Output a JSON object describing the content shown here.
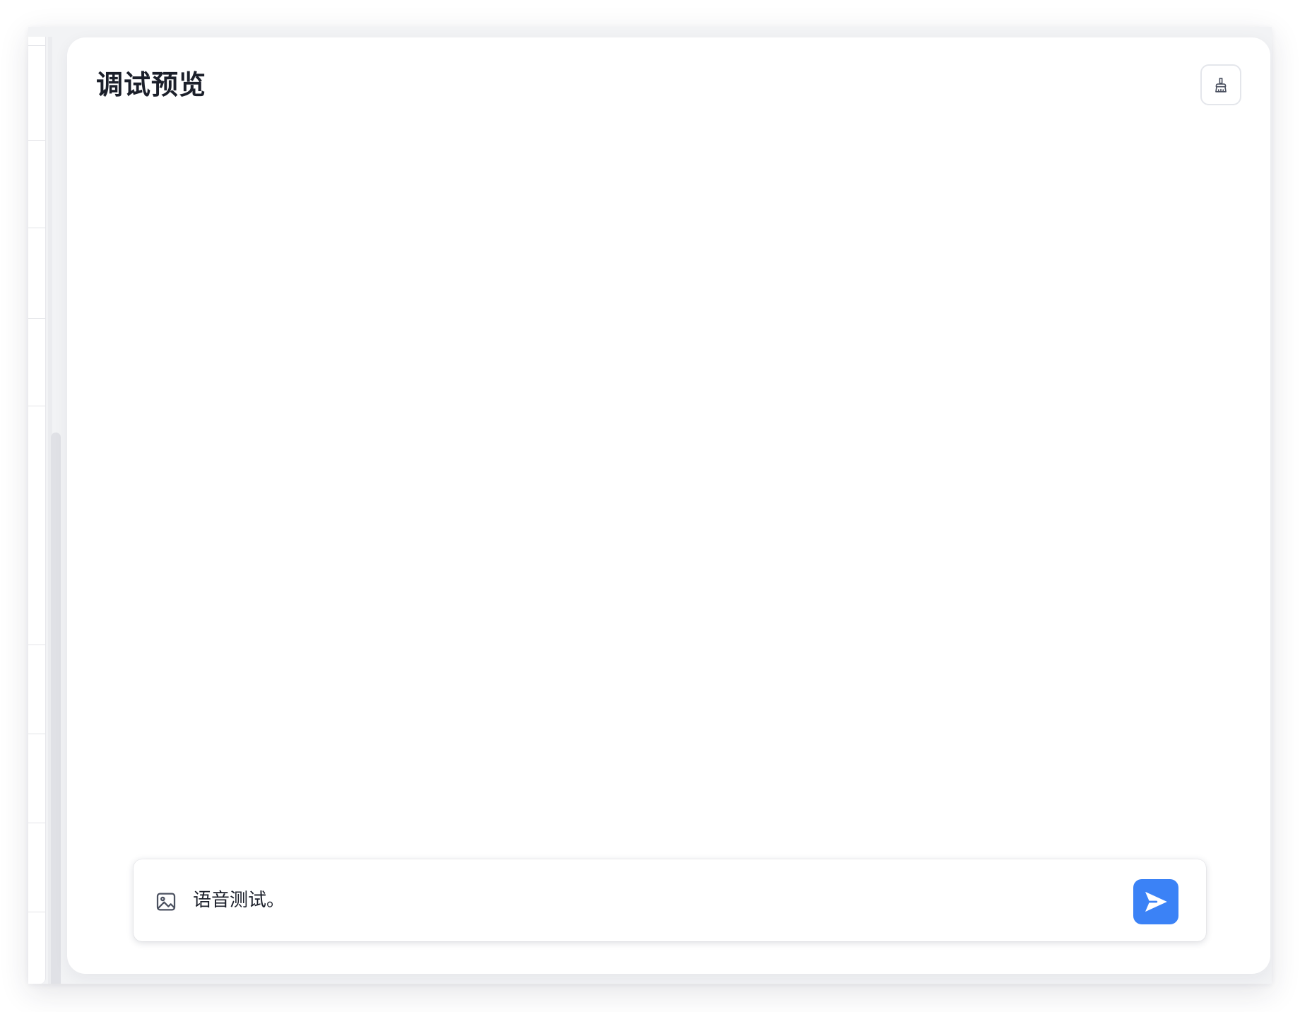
{
  "dialog": {
    "title": "调试预览",
    "clear_icon": "broom-icon"
  },
  "input": {
    "value": "语音测试。",
    "image_icon": "image-icon",
    "send_icon": "send-icon"
  },
  "colors": {
    "accent": "#3b82f6",
    "title_text": "#1b1f2a",
    "shell_bg": "#f2f3f5",
    "card_bg": "#ffffff"
  }
}
